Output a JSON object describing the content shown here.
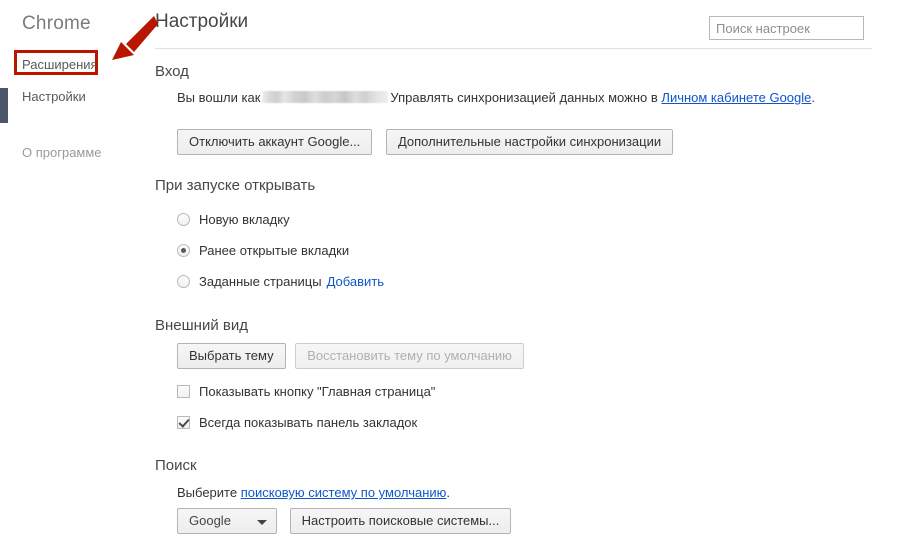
{
  "sidebar": {
    "brand": "Chrome",
    "items": [
      {
        "id": "extensions",
        "label": "Расширения"
      },
      {
        "id": "settings",
        "label": "Настройки"
      },
      {
        "id": "about",
        "label": "О программе"
      }
    ]
  },
  "annotation": {
    "color": "#b81600",
    "highlight_target": "Расширения",
    "arrow": "arrow-pointing-down-left"
  },
  "header": {
    "title": "Настройки",
    "search_placeholder": "Поиск настроек",
    "search_value": ""
  },
  "signin": {
    "title": "Вход",
    "text_before_user": "Вы вошли как",
    "user_redacted": "",
    "text_after_user": "Управлять синхронизацией данных можно в",
    "link_label": "Личном кабинете Google",
    "sentence_end": ".",
    "disconnect_button": "Отключить аккаунт Google...",
    "advanced_sync_button": "Дополнительные настройки синхронизации"
  },
  "startup": {
    "title": "При запуске открывать",
    "options": [
      {
        "label": "Новую вкладку",
        "checked": false
      },
      {
        "label": "Ранее открытые вкладки",
        "checked": true
      },
      {
        "label": "Заданные страницы",
        "checked": false,
        "link": "Добавить"
      }
    ]
  },
  "appearance": {
    "title": "Внешний вид",
    "choose_theme_button": "Выбрать тему",
    "reset_theme_button": "Восстановить тему по умолчанию",
    "reset_theme_disabled": true,
    "checkboxes": [
      {
        "label": "Показывать кнопку \"Главная страница\"",
        "checked": false
      },
      {
        "label": "Всегда показывать панель закладок",
        "checked": true
      }
    ]
  },
  "search": {
    "title": "Поиск",
    "prefix_text": "Выберите",
    "link_label": "поисковую систему по умолчанию",
    "suffix_text": ".",
    "engine_selected": "Google",
    "engine_options": [
      "Google"
    ],
    "manage_button": "Настроить поисковые системы..."
  },
  "colors": {
    "annotation_red": "#b81600",
    "link_blue": "#1155cc",
    "edge_marker": "#4c586a"
  }
}
